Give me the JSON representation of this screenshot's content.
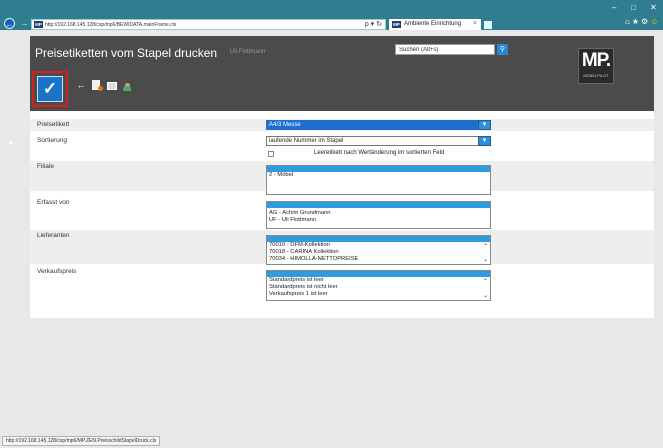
{
  "browser": {
    "url": "http://192.168.145.128/csp/mp6/BEWIDATA.mainFrame.cls",
    "tab_title": "Ambiente Einrichtung",
    "mp_icon_text": "MP"
  },
  "header": {
    "title": "Preisetiketten vom Stapel drucken",
    "user": "Uli Flottmann",
    "search_placeholder": "Suchen (Alt+s)",
    "logo_text": "MP.",
    "logo_sub": "MÖBELPILOT"
  },
  "form": {
    "preisetikett": {
      "label": "Preisetikett",
      "value": "A4/3 Messe"
    },
    "sortierung": {
      "label": "Sortierung",
      "value": "laufende Nummer im Stapel"
    },
    "leeretikett": {
      "label": "Leeretikett nach Wertänderung im sortierten Feld",
      "checked": false
    },
    "filiale": {
      "label": "Filiale",
      "items": [
        "2 - Möbel"
      ]
    },
    "erfasst_von": {
      "label": "Erfasst von",
      "items": [
        "AG - Achim Grundmann",
        "UF - Uli Flottmann"
      ]
    },
    "lieferanten": {
      "label": "Lieferanten",
      "items": [
        "70010 - DFM-Kollektion",
        "70018 - CARINA Kollektion",
        "70034 - HIMOLLA-NETTOPREISE"
      ]
    },
    "verkaufspreis": {
      "label": "Verkaufspreis",
      "items": [
        "Standardpreis ist leer",
        "Standardpreis ist nicht leer",
        "Verkaufspreis 1 ist leer"
      ]
    }
  },
  "status_bar": "http://192.168.145.128/csp/mp6/MP.ZEN.PreisschildStapelDruck.cls",
  "colors": {
    "accent": "#1a73c9",
    "banner": "#4b4b4b",
    "highlight": "#d92020"
  }
}
